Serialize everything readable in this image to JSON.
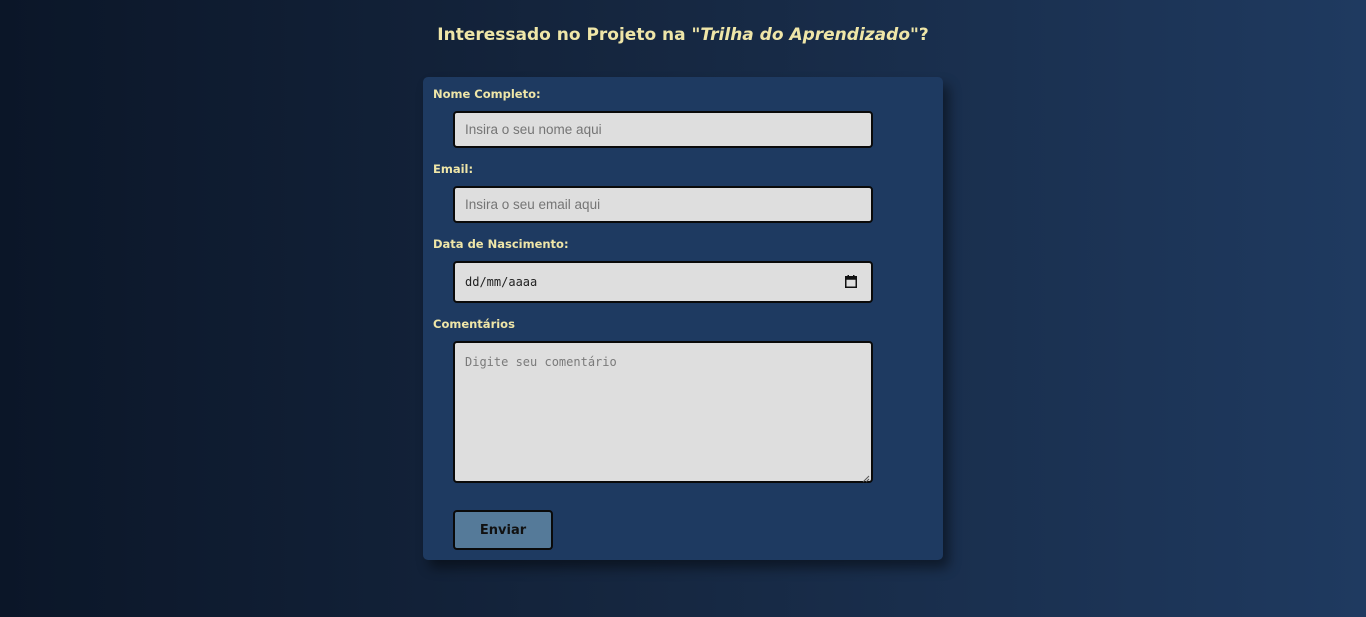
{
  "header": {
    "title_prefix": "Interessado no Projeto na \"",
    "title_emphasis": "Trilha do Aprendizado",
    "title_suffix": "\"?"
  },
  "form": {
    "name": {
      "label": "Nome Completo:",
      "placeholder": "Insira o seu nome aqui",
      "value": ""
    },
    "email": {
      "label": "Email:",
      "placeholder": "Insira o seu email aqui",
      "value": ""
    },
    "birthdate": {
      "label": "Data de Nascimento:",
      "placeholder": "dd/mm/aaaa",
      "icon": "calendar-icon"
    },
    "comments": {
      "label": "Comentários",
      "placeholder": "Digite seu comentário",
      "value": ""
    },
    "submit_label": "Enviar"
  },
  "colors": {
    "background_start": "#0b1628",
    "background_end": "#1f3a60",
    "card": "#1e3a61",
    "label_text": "#efe6a8",
    "input_bg": "#dedede",
    "button_bg": "#557a99"
  }
}
